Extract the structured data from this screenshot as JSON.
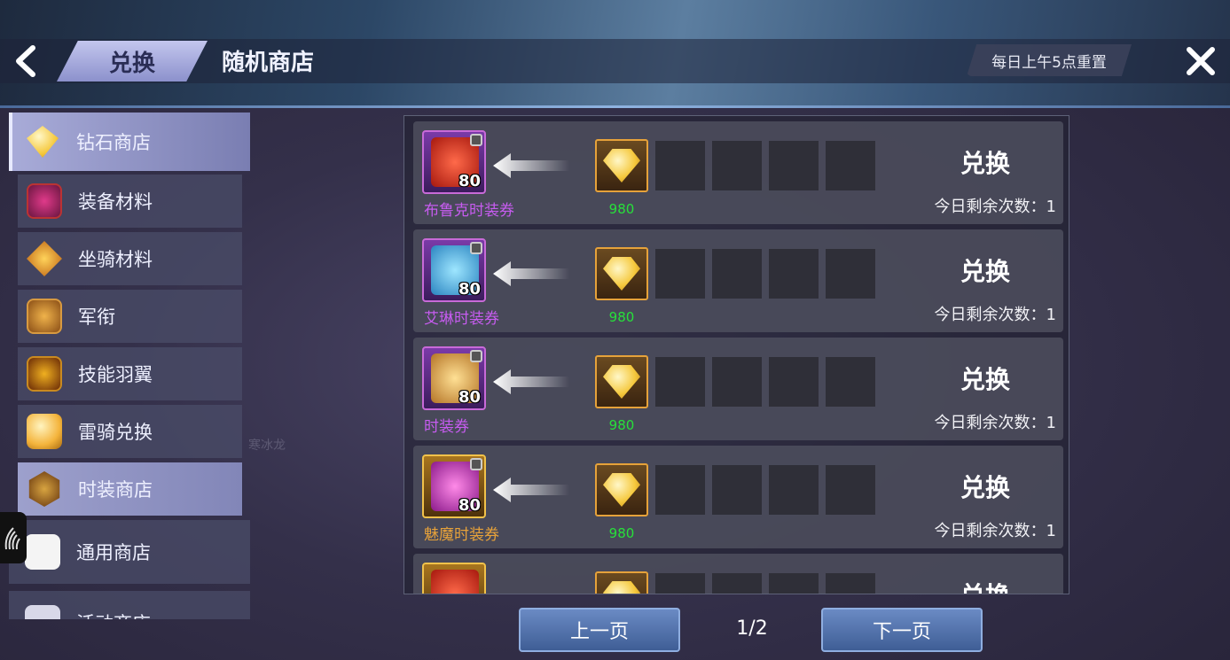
{
  "header": {
    "back_icon": "chevron-left-icon",
    "tab_exchange": "兑换",
    "tab_random_shop": "随机商店",
    "reset_note": "每日上午5点重置",
    "close_icon": "close-icon"
  },
  "sidebar": {
    "items": [
      {
        "label": "钻石商店",
        "icon": "diamond-icon"
      },
      {
        "label": "装备材料",
        "icon": "equipment-material-icon"
      },
      {
        "label": "坐骑材料",
        "icon": "mount-material-icon"
      },
      {
        "label": "军衔",
        "icon": "rank-icon"
      },
      {
        "label": "技能羽翼",
        "icon": "skill-wing-icon"
      },
      {
        "label": "雷骑兑换",
        "icon": "thunder-rider-icon"
      },
      {
        "label": "时装商店",
        "icon": "fashion-shop-icon"
      },
      {
        "label": "通用商店",
        "icon": "common-shop-icon"
      },
      {
        "label": "活动商店",
        "icon": "activity-shop-icon"
      }
    ],
    "background_text": "寒冰龙"
  },
  "exchange_list": {
    "items": [
      {
        "name": "布鲁克时装券",
        "count": "80",
        "cost": "980",
        "action": "兑换",
        "remaining": "今日剩余次数：1",
        "rarity": "purple"
      },
      {
        "name": "艾琳时装券",
        "count": "80",
        "cost": "980",
        "action": "兑换",
        "remaining": "今日剩余次数：1",
        "rarity": "purple"
      },
      {
        "name": "时装券",
        "count": "80",
        "cost": "980",
        "action": "兑换",
        "remaining": "今日剩余次数：1",
        "rarity": "purple"
      },
      {
        "name": "魅魔时装券",
        "count": "80",
        "cost": "980",
        "action": "兑换",
        "remaining": "今日剩余次数：1",
        "rarity": "gold"
      },
      {
        "name": "",
        "count": "",
        "cost": "",
        "action": "兑换",
        "remaining": "",
        "rarity": "gold"
      }
    ]
  },
  "pagination": {
    "prev": "上一页",
    "indicator": "1/2",
    "next": "下一页"
  }
}
